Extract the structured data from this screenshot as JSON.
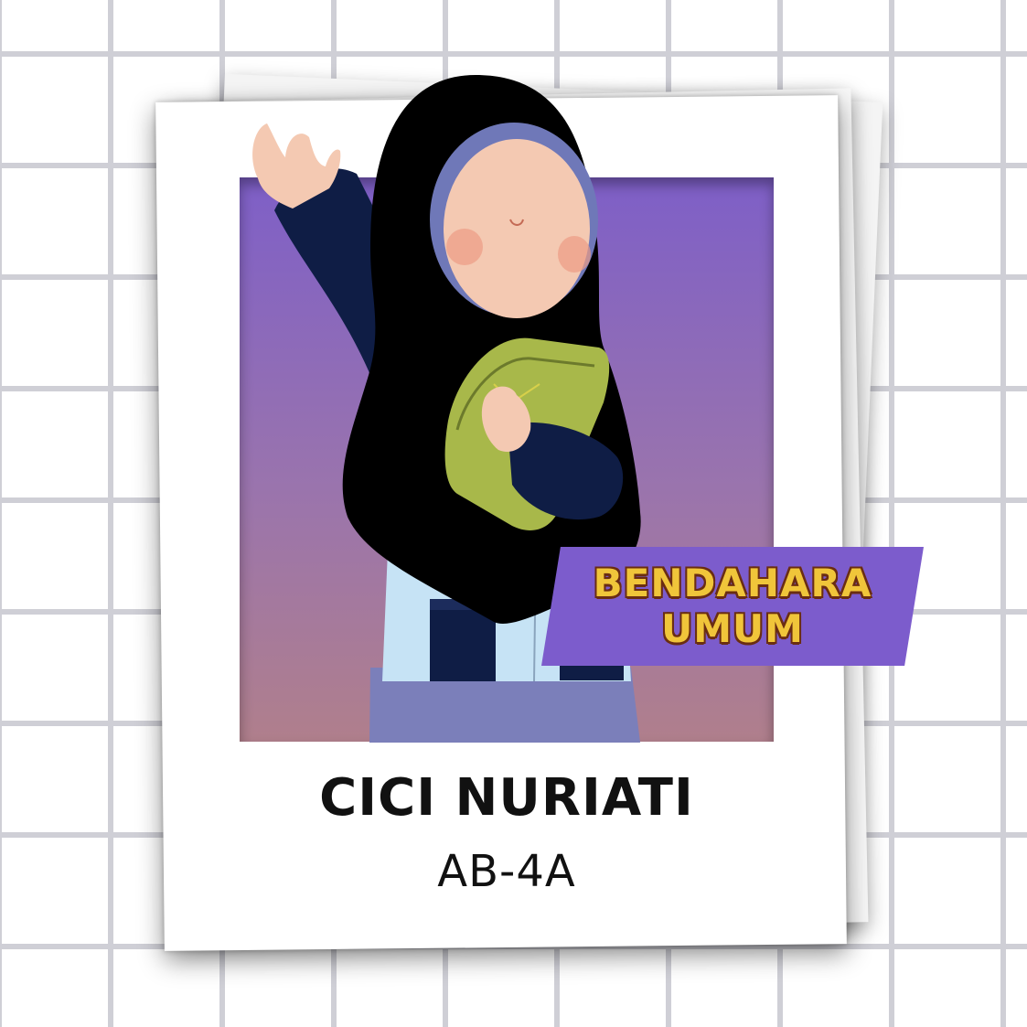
{
  "card": {
    "role_line_1": "BENDAHARA",
    "role_line_2": "UMUM",
    "name": "CICI NURIATI",
    "class_code": "AB-4A"
  },
  "colors": {
    "photo_top": "#7e5fc7",
    "photo_bottom": "#b07f8c",
    "badge_background": "#7c5ccc",
    "badge_text": "#f0c53a",
    "hijab": "#000000",
    "sleeve": "#0f1d45",
    "book": "#a8b84a",
    "shirt": "#c6e3f5",
    "skirt": "#7b7fba",
    "skin": "#f4c9b2"
  },
  "icons": {
    "figure": "girl-in-hijab-illustration"
  }
}
